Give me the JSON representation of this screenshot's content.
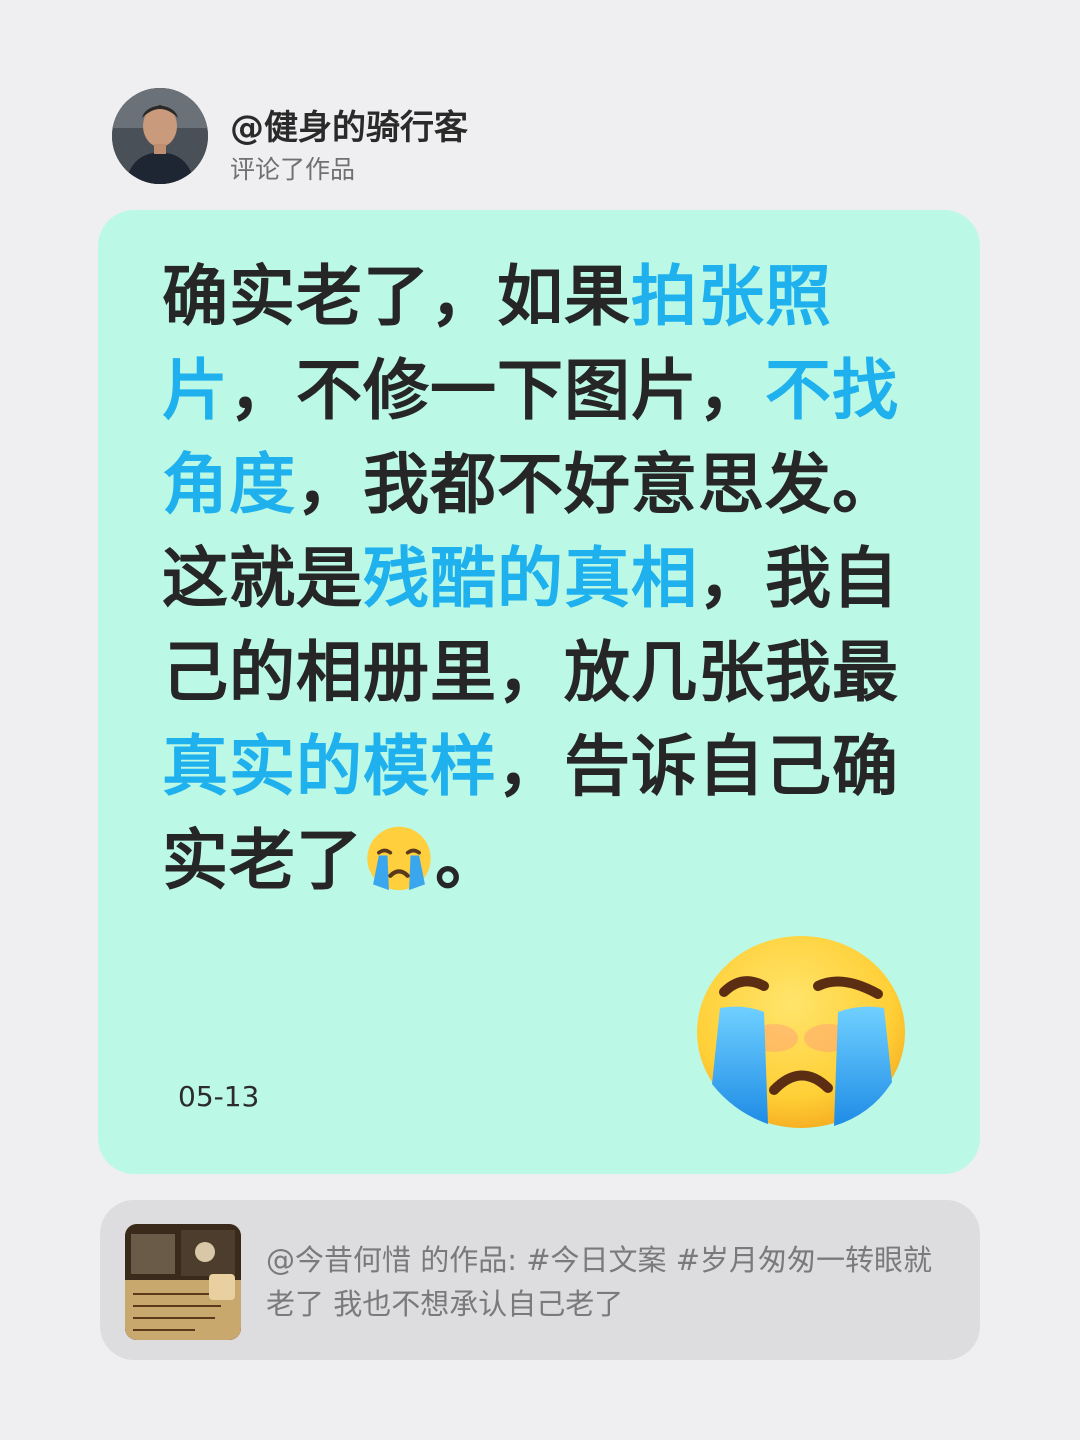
{
  "author": {
    "username": "@健身的骑行客",
    "action": "评论了作品",
    "avatar_icon": "user-avatar-photo"
  },
  "comment": {
    "segments": [
      {
        "text": "确实老了，如果",
        "highlight": false
      },
      {
        "text": "拍张照片",
        "highlight": true
      },
      {
        "text": "，不修一下图片，",
        "highlight": false
      },
      {
        "text": "不找角度",
        "highlight": true
      },
      {
        "text": "，我都不好意思发。这就是",
        "highlight": false
      },
      {
        "text": "残酷的真相",
        "highlight": true
      },
      {
        "text": "，我自己的相册里，放几张我最",
        "highlight": false
      },
      {
        "text": "真实的模样",
        "highlight": true
      },
      {
        "text": "，告诉自己确实老了",
        "highlight": false
      },
      {
        "text": "。",
        "highlight": false
      }
    ],
    "inline_emoji": "loudly-crying-face-emoji",
    "big_emoji": "loudly-crying-face-emoji",
    "date": "05-13",
    "highlight_color": "#1fb0ee",
    "card_color": "#bcf8e6"
  },
  "reference": {
    "text": "@今昔何惜 的作品: #今日文案 #岁月匆匆一转眼就老了 我也不想承认自己老了",
    "thumbnail_icon": "work-thumbnail-image"
  }
}
